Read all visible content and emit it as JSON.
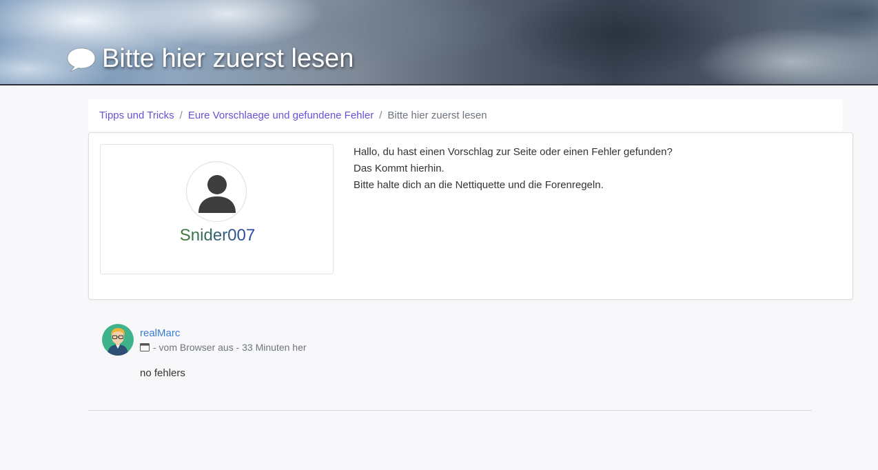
{
  "header": {
    "title": "Bitte hier zuerst lesen",
    "icon": "chat-bubble-icon"
  },
  "breadcrumb": {
    "items": [
      "Tipps und Tricks",
      "Eure Vorschlaege und gefundene Fehler"
    ],
    "current": "Bitte hier zuerst lesen",
    "separator": "/"
  },
  "post": {
    "author": "Snider007",
    "author_icon": "user-silhouette-icon",
    "lines": [
      "Hallo, du hast einen Vorschlag zur Seite oder einen Fehler gefunden?",
      "Das Kommt hierhin.",
      "Bitte halte dich an die Nettiquette und die Forenregeln."
    ]
  },
  "comment": {
    "user": "realMarc",
    "meta": "- vom Browser aus - 33 Minuten her",
    "meta_icon": "browser-window-icon",
    "body": "no fehlers"
  },
  "colors": {
    "link": "#6a4fd8",
    "comment_user": "#3a7bd5",
    "background": "#f8f8fa"
  }
}
